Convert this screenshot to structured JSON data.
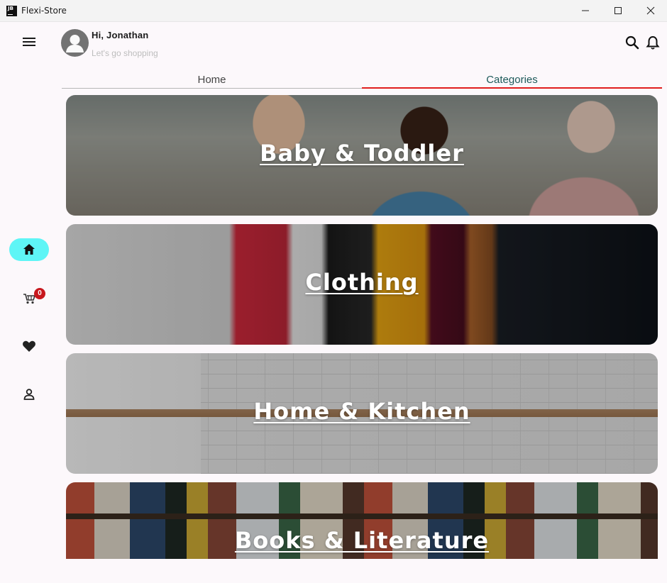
{
  "window": {
    "app_icon_text": "JB",
    "title": "Flexi-Store"
  },
  "header": {
    "greeting": "Hi, Jonathan",
    "subtitle": "Let's go shopping"
  },
  "tabs": [
    {
      "label": "Home",
      "selected": false
    },
    {
      "label": "Categories",
      "selected": true
    }
  ],
  "nav": {
    "items": [
      {
        "icon": "home-icon",
        "selected": true
      },
      {
        "icon": "cart-icon",
        "badge": "0"
      },
      {
        "icon": "heart-icon"
      },
      {
        "icon": "person-icon"
      }
    ]
  },
  "categories": [
    {
      "label": "Baby & Toddler"
    },
    {
      "label": "Clothing"
    },
    {
      "label": "Home & Kitchen"
    },
    {
      "label": "Books & Literature"
    }
  ],
  "colors": {
    "accent_nav": "#5ef5f6",
    "tab_indicator": "#e01e1e",
    "tab_selected_text": "#1d5a5a",
    "badge": "#c7171d"
  }
}
